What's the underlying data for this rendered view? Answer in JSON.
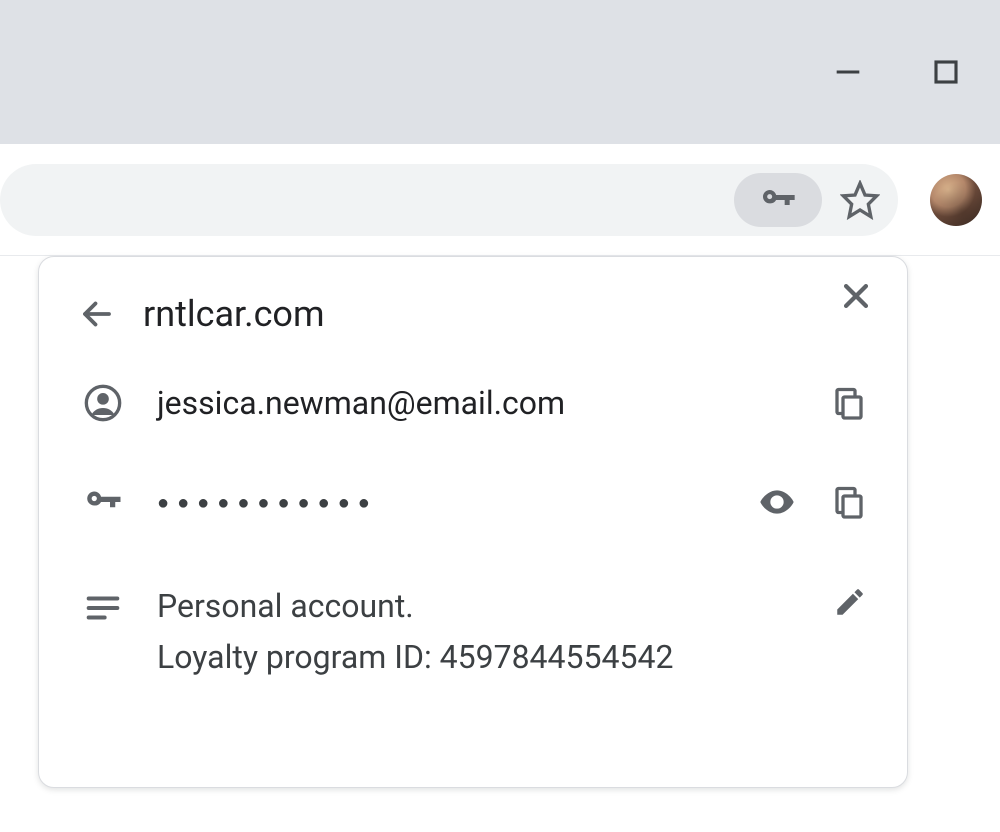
{
  "popup": {
    "site": "rntlcar.com",
    "username": "jessica.newman@email.com",
    "password_mask": "●●●●●●●●●●●",
    "note_line1": "Personal account.",
    "note_line2": "Loyalty program ID: 4597844554542"
  }
}
